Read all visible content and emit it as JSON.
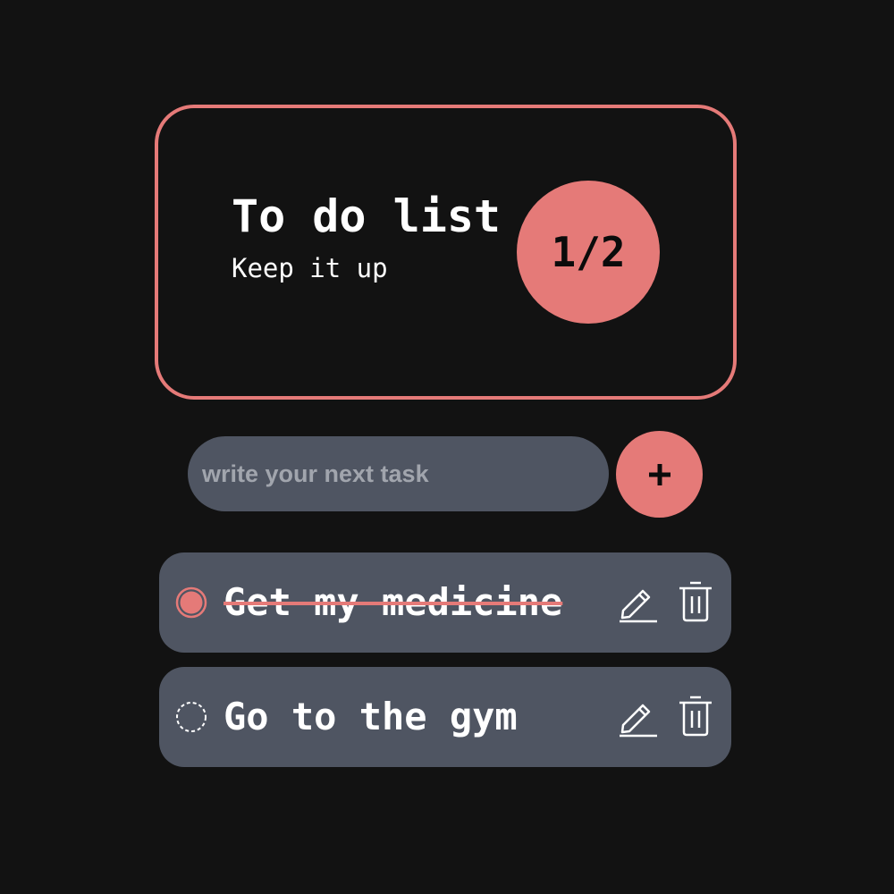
{
  "header": {
    "title": "To do list",
    "subtitle": "Keep it up",
    "progress": "1/2"
  },
  "input": {
    "placeholder": "write your next task",
    "value": ""
  },
  "add_button": {
    "label": "+",
    "icon": "plus-icon"
  },
  "tasks": [
    {
      "text": "Get my medicine",
      "completed": true
    },
    {
      "text": "Go to the gym",
      "completed": false
    }
  ],
  "icons": {
    "edit": "pencil-icon",
    "delete": "trash-icon",
    "check_done": "checked-circle-icon",
    "check_todo": "dashed-circle-icon"
  },
  "colors": {
    "background": "#121212",
    "accent": "#e57a78",
    "row": "#4f5562",
    "placeholder": "#a1a5ad",
    "text": "#ffffff"
  }
}
